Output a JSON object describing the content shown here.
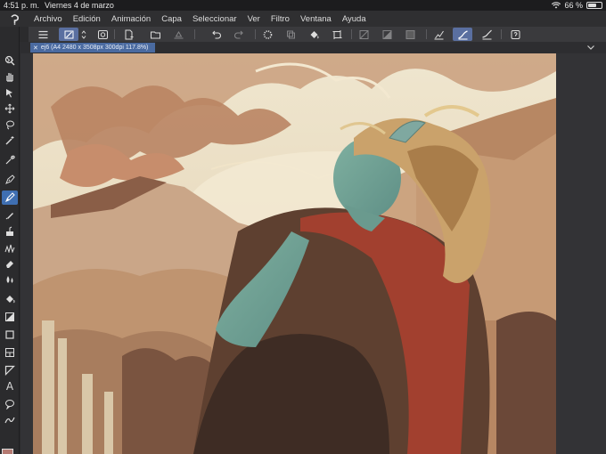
{
  "status": {
    "time": "4:51 p. m.",
    "date": "Viernes 4 de marzo",
    "battery": "66 %",
    "battery_level": 0.66
  },
  "menu": [
    "Archivo",
    "Edición",
    "Animación",
    "Capa",
    "Seleccionar",
    "Ver",
    "Filtro",
    "Ventana",
    "Ayuda"
  ],
  "tab": {
    "label": "ej6 (A4 2480 x 3508px 300dpi 117.8%)"
  },
  "toolbar": {
    "selected": "transform-tool"
  },
  "left_tools": {
    "selected": "brush-tool",
    "text_tool_label": "A"
  },
  "colors": {
    "foreground": "#b57a72",
    "background": "#f4f1ea",
    "accent": "#3f6fb2"
  }
}
